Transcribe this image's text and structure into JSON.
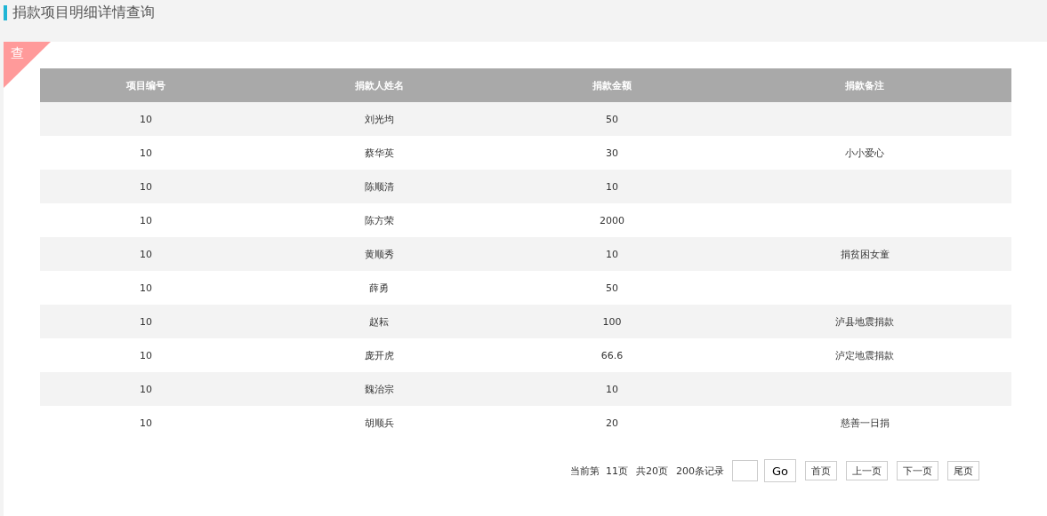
{
  "page_title": "捐款项目明细详情查询",
  "corner_badge": "查",
  "table": {
    "columns": [
      "项目编号",
      "捐款人姓名",
      "捐款金额",
      "捐款备注"
    ],
    "rows": [
      [
        "10",
        "刘光均",
        "50",
        ""
      ],
      [
        "10",
        "蔡华英",
        "30",
        "小小爱心"
      ],
      [
        "10",
        "陈顺清",
        "10",
        ""
      ],
      [
        "10",
        "陈方荣",
        "2000",
        ""
      ],
      [
        "10",
        "黄顺秀",
        "10",
        "捐贫困女童"
      ],
      [
        "10",
        "薛勇",
        "50",
        ""
      ],
      [
        "10",
        "赵耘",
        "100",
        "泸县地震捐款"
      ],
      [
        "10",
        "庞开虎",
        "66.6",
        "泸定地震捐款"
      ],
      [
        "10",
        "魏治宗",
        "10",
        ""
      ],
      [
        "10",
        "胡顺兵",
        "20",
        "慈善一日捐"
      ]
    ]
  },
  "pagination": {
    "current": "当前第  11页",
    "total_pages": "共20页",
    "total_records": "200条记录",
    "go": "Go",
    "buttons": [
      "首页",
      "上一页",
      "下一页",
      "尾页"
    ]
  }
}
